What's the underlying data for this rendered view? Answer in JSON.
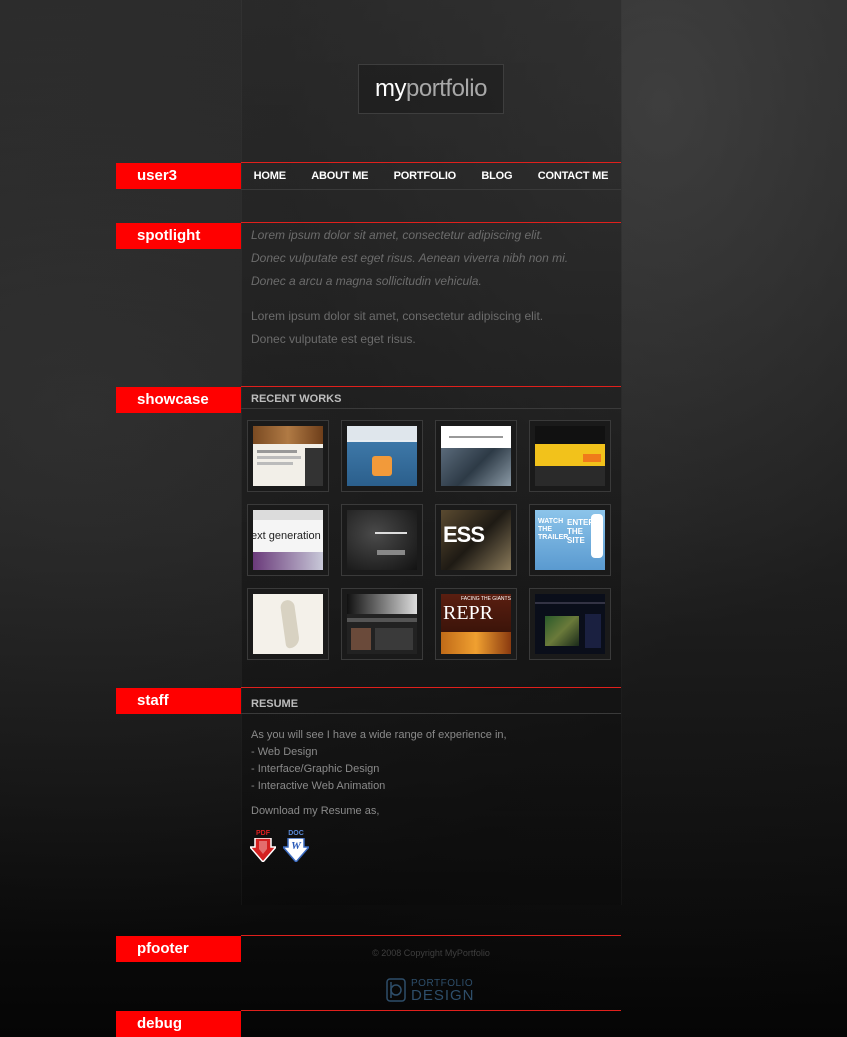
{
  "logo": {
    "my": "my",
    "portfolio": "portfolio"
  },
  "positions": {
    "user3": "user3",
    "spotlight": "spotlight",
    "showcase": "showcase",
    "staff": "staff",
    "pfooter": "pfooter",
    "debug": "debug"
  },
  "nav": {
    "items": [
      "HOME",
      "ABOUT ME",
      "PORTFOLIO",
      "BLOG",
      "CONTACT ME"
    ]
  },
  "spotlight": {
    "italic_lines": [
      "Lorem ipsum dolor sit amet, consectetur adipiscing elit.",
      "Donec vulputate est eget risus. Aenean viverra nibh non mi.",
      "Donec a arcu a magna sollicitudin vehicula."
    ],
    "normal_lines": [
      "Lorem ipsum dolor sit amet, consectetur adipiscing elit.",
      "Donec vulputate est eget risus."
    ]
  },
  "showcase": {
    "heading": "RECENT WORKS",
    "thumb_texts": {
      "next_gen": "ext generation of",
      "ess": "ESS",
      "watch": "WATCH THE TRAILER",
      "enter": "ENTER THE SITE",
      "repr": "REPR",
      "giants": "FACING THE GIANTS"
    }
  },
  "staff": {
    "heading": "RESUME",
    "intro": "As you will see I have a wide range of experience in,",
    "items": [
      "- Web Design",
      "- Interface/Graphic Design",
      "- Interactive Web Animation"
    ],
    "download_label": "Download my Resume as,",
    "pdf_tag": "PDF",
    "doc_tag": "DOC",
    "doc_glyph": "W"
  },
  "footer": {
    "copyright": "© 2008 Copyright MyPortfolio",
    "logo_line1": "PORTFOLIO",
    "logo_line2": "DESIGN"
  },
  "colors": {
    "accent": "#ff0000",
    "rule": "#e0201c",
    "text_muted": "#6c6c6c"
  }
}
